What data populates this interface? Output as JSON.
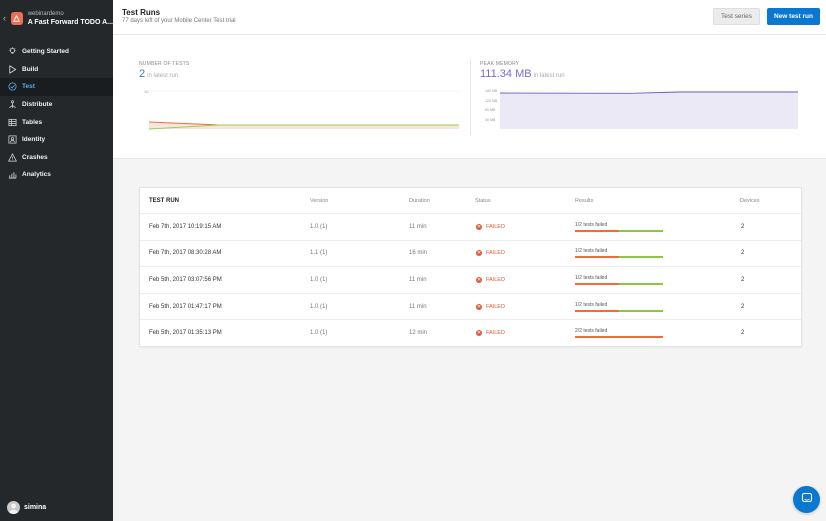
{
  "app": {
    "owner": "webinardemo",
    "name": "A Fast Forward TODO A...",
    "icon": "app-logo-icon",
    "accent": "#f26b55"
  },
  "sidebar": {
    "items": [
      {
        "label": "Getting Started",
        "icon": "lightbulb-icon"
      },
      {
        "label": "Build",
        "icon": "play-icon"
      },
      {
        "label": "Test",
        "icon": "check-circle-icon",
        "active": true
      },
      {
        "label": "Distribute",
        "icon": "distribute-icon"
      },
      {
        "label": "Tables",
        "icon": "tables-icon"
      },
      {
        "label": "Identity",
        "icon": "identity-icon"
      },
      {
        "label": "Crashes",
        "icon": "warning-icon"
      },
      {
        "label": "Analytics",
        "icon": "bar-chart-icon"
      }
    ],
    "user": "simina"
  },
  "header": {
    "title": "Test Runs",
    "subtitle": "77 days left of your Mobile Center Test trial",
    "secondary_button": "Test series",
    "primary_button": "New test run"
  },
  "metrics": {
    "tests": {
      "label": "NUMBER OF TESTS",
      "value": "2",
      "sub": "in latest run",
      "axis_label": "10",
      "color": "#3d7fc1"
    },
    "memory": {
      "label": "PEAK MEMORY",
      "value": "111.34 MB",
      "sub": "in latest run",
      "axis_labels": [
        "160 MB",
        "120 MB",
        "80 MB",
        "40 MB"
      ],
      "color": "#7d6bc4"
    }
  },
  "table": {
    "headers": [
      "TEST RUN",
      "Version",
      "Duration",
      "Status",
      "Results",
      "Devices"
    ],
    "rows": [
      {
        "run": "Feb 7th, 2017 10:19:15 AM",
        "version": "1.0 (1)",
        "duration": "11 min",
        "status": "FAILED",
        "result": "1/2 tests failed",
        "failed_fraction": 0.5,
        "devices": "2"
      },
      {
        "run": "Feb 7th, 2017 08:30:28 AM",
        "version": "1.1 (1)",
        "duration": "16 min",
        "status": "FAILED",
        "result": "1/2 tests failed",
        "failed_fraction": 0.5,
        "devices": "2"
      },
      {
        "run": "Feb 5th, 2017 03:07:56 PM",
        "version": "1.0 (1)",
        "duration": "11 min",
        "status": "FAILED",
        "result": "1/2 tests failed",
        "failed_fraction": 0.5,
        "devices": "2"
      },
      {
        "run": "Feb 5th, 2017 01:47:17 PM",
        "version": "1.0 (1)",
        "duration": "11 min",
        "status": "FAILED",
        "result": "1/2 tests failed",
        "failed_fraction": 0.5,
        "devices": "2"
      },
      {
        "run": "Feb 5th, 2017 01:35:13 PM",
        "version": "1.0 (1)",
        "duration": "12 min",
        "status": "FAILED",
        "result": "2/2 tests failed",
        "failed_fraction": 1.0,
        "devices": "2"
      }
    ]
  },
  "colors": {
    "failed": "#e05a3c",
    "passed": "#8dc63f",
    "primary": "#0a78d1"
  }
}
